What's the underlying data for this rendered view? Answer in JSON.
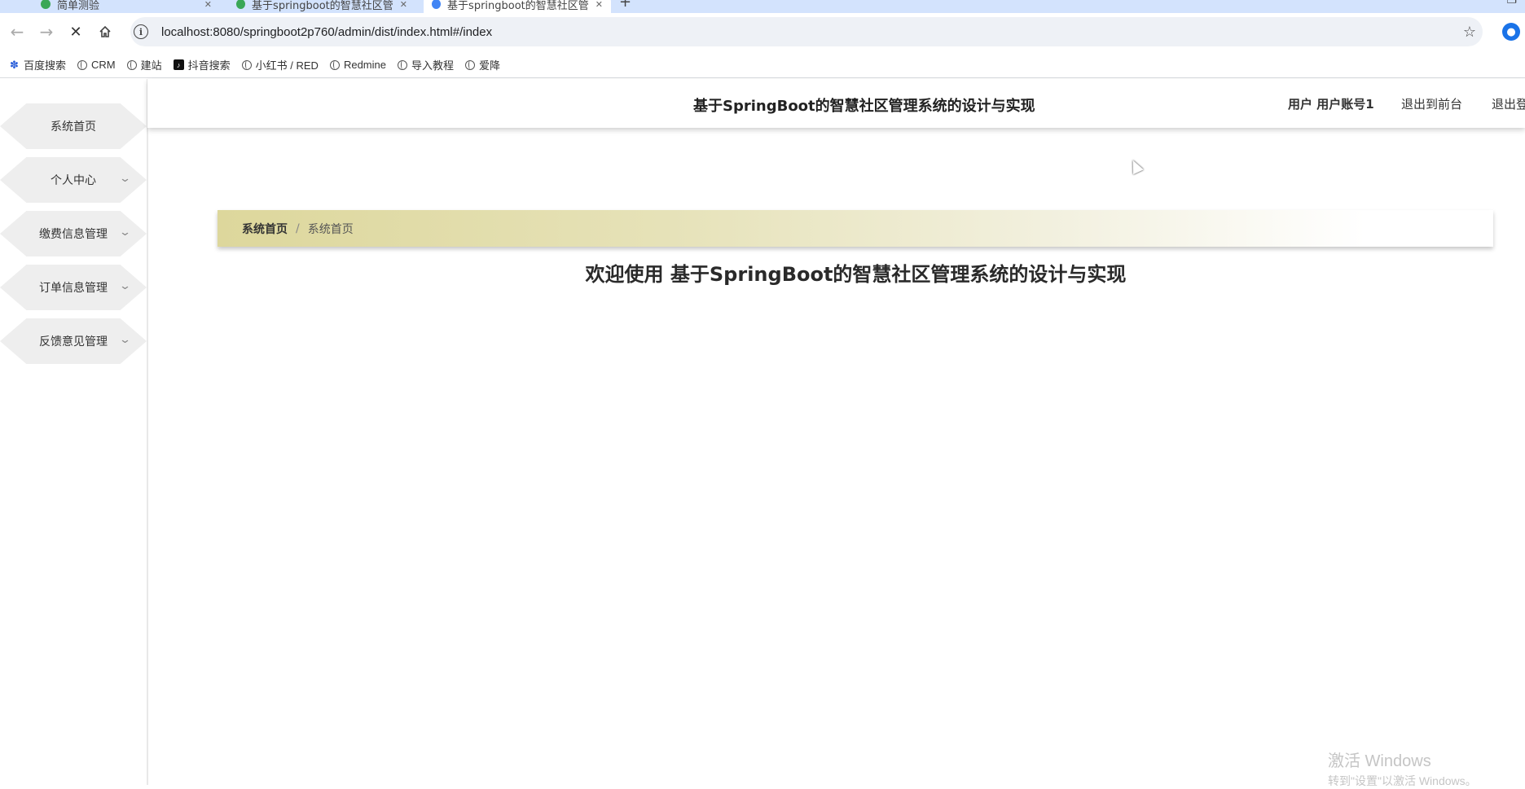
{
  "browser": {
    "tabs": [
      {
        "title": "简单测验"
      },
      {
        "title": "基于springboot的智慧社区管"
      },
      {
        "title": "基于springboot的智慧社区管"
      }
    ],
    "url": "localhost:8080/springboot2p760/admin/dist/index.html#/index",
    "bookmarks": [
      "百度搜索",
      "CRM",
      "建站",
      "抖音搜索",
      "小红书 / RED",
      "Redmine",
      "导入教程",
      "爱降"
    ]
  },
  "sidebar": {
    "items": [
      {
        "label": "系统首页"
      },
      {
        "label": "个人中心"
      },
      {
        "label": "缴费信息管理"
      },
      {
        "label": "订单信息管理"
      },
      {
        "label": "反馈意见管理"
      }
    ]
  },
  "header": {
    "title": "基于SpringBoot的智慧社区管理系统的设计与实现",
    "user": "用户 用户账号1",
    "front": "退出到前台",
    "logout": "退出登录"
  },
  "breadcrumb": {
    "home": "系统首页",
    "separator": "/",
    "current": "系统首页"
  },
  "main": {
    "welcome": "欢迎使用 基于SpringBoot的智慧社区管理系统的设计与实现"
  },
  "watermark": {
    "line1": "激活 Windows",
    "line2": "转到\"设置\"以激活 Windows。"
  }
}
